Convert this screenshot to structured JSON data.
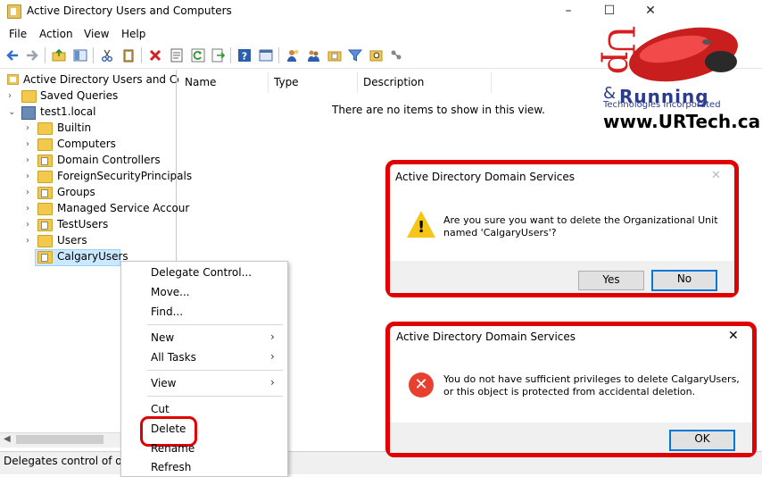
{
  "window": {
    "title": "Active Directory Users and Computers",
    "minimize": "–",
    "maximize": "☐",
    "close": "✕"
  },
  "menu": [
    "File",
    "Action",
    "View",
    "Help"
  ],
  "tree": {
    "root": "Active Directory Users and Com",
    "saved_queries": "Saved Queries",
    "domain": "test1.local",
    "children": [
      "Builtin",
      "Computers",
      "Domain Controllers",
      "ForeignSecurityPrincipals",
      "Groups",
      "Managed Service Accour",
      "TestUsers",
      "Users",
      "CalgaryUsers"
    ]
  },
  "list": {
    "columns": [
      "Name",
      "Type",
      "Description"
    ],
    "empty_message": "There are no items to show in this view."
  },
  "status": {
    "text": "Delegates control of obje"
  },
  "context_menu": {
    "items": [
      "Delegate Control...",
      "Move...",
      "Find...",
      "New",
      "All Tasks",
      "View",
      "Cut",
      "Delete",
      "Rename",
      "Refresh"
    ],
    "submenu_arrow": "›"
  },
  "dialog_confirm": {
    "title": "Active Directory Domain Services",
    "line1": "Are you sure you want to delete the Organizational Unit",
    "line2": "named 'CalgaryUsers'?",
    "yes": "Yes",
    "no": "No",
    "close": "✕"
  },
  "dialog_error": {
    "title": "Active Directory Domain Services",
    "line1": "You do not have sufficient privileges to delete CalgaryUsers,",
    "line2": "or this object is protected from accidental deletion.",
    "ok": "OK",
    "close": "✕"
  },
  "logo": {
    "up": "Up",
    "amp": "&",
    "running": "Running",
    "sub": "Technologies Incorporated",
    "url": "www.URTech.ca"
  },
  "colors": {
    "highlight_red": "#e00000",
    "selection": "#cce8ff",
    "accent_blue": "#0078d7"
  }
}
